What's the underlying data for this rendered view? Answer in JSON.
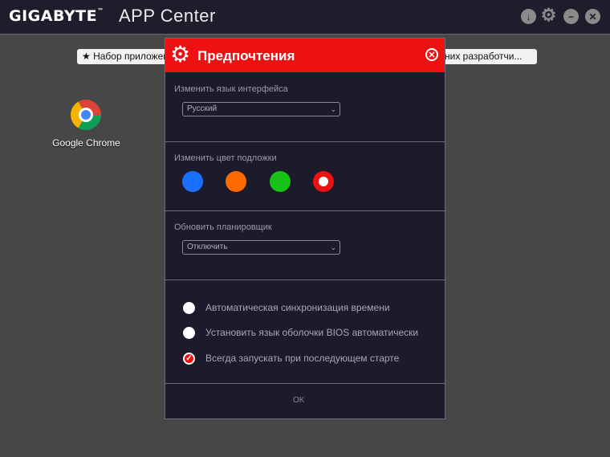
{
  "titlebar": {
    "brand": "GIGABYTE",
    "brand_tm": "™",
    "app_title": "APP Center",
    "buttons": [
      {
        "name": "download-icon",
        "glyph": "↓"
      },
      {
        "name": "gear-icon",
        "glyph": "⚙"
      },
      {
        "name": "minimize-icon",
        "glyph": "−"
      },
      {
        "name": "close-icon",
        "glyph": "✕"
      }
    ]
  },
  "desktop": {
    "pill_left": "★ Набор приложений",
    "pill_right": "них разработчи...",
    "apps": [
      {
        "label": "Google Chrome",
        "icon": "chrome-icon"
      }
    ]
  },
  "dialog": {
    "title": "Предпочтения",
    "language": {
      "label": "Изменить язык интерфейса",
      "value": "Русский"
    },
    "color": {
      "label": "Изменить цвет подложки",
      "options": [
        "#1a6fff",
        "#ff6a00",
        "#19c219",
        "#ee1111"
      ],
      "selected_index": 3
    },
    "scheduler": {
      "label": "Обновить планировщик",
      "value": "Отключить"
    },
    "options": [
      {
        "label": "Автоматическая синхронизация времени",
        "checked": false
      },
      {
        "label": "Установить язык оболочки BIOS автоматически",
        "checked": false
      },
      {
        "label": "Всегда запускать при последующем старте",
        "checked": true
      }
    ],
    "ok_label": "OK"
  }
}
